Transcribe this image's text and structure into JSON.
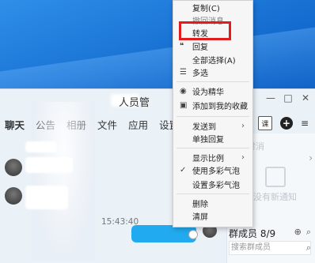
{
  "chat": {
    "title": "人员管",
    "tabs": [
      "聊天",
      "公告",
      "相册",
      "文件",
      "应用",
      "设置"
    ],
    "timestamp": "15:43:40",
    "sidebar_faint_1": "即时消",
    "sidebar_faint_2": "暂没有新通知",
    "member_header": "群成员 8/9",
    "member_search_placeholder": "搜索群成员"
  },
  "toolbar": {
    "doc_icon_label": "课"
  },
  "context_menu": {
    "items": [
      {
        "label": "复制(C)"
      },
      {
        "label": "撤回消息"
      },
      {
        "label": "转发"
      },
      {
        "label": "回复"
      },
      {
        "label": "全部选择(A)"
      },
      {
        "label": "多选"
      },
      {
        "label": "设为精华"
      },
      {
        "label": "添加到我的收藏"
      },
      {
        "label": "发送到"
      },
      {
        "label": "单独回复"
      },
      {
        "label": "显示比例"
      },
      {
        "label": "使用多彩气泡"
      },
      {
        "label": "设置多彩气泡"
      },
      {
        "label": "删除"
      },
      {
        "label": "清屏"
      }
    ]
  }
}
